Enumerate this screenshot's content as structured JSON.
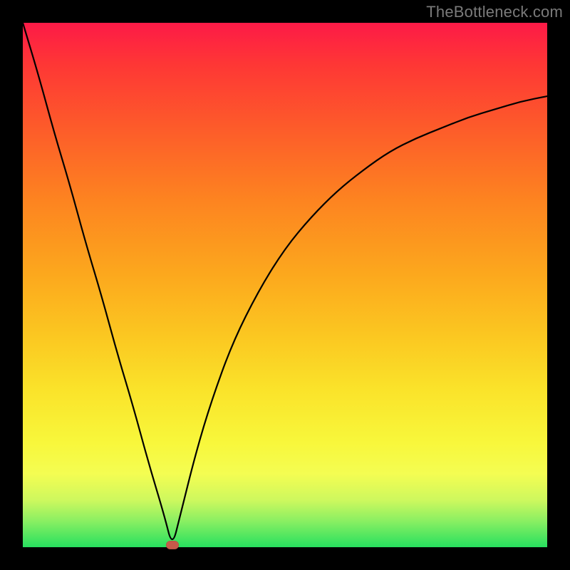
{
  "watermark": "TheBottleneck.com",
  "colors": {
    "curve_stroke": "#000000",
    "marker_fill": "#c75a4a",
    "frame": "#000000"
  },
  "chart_data": {
    "type": "line",
    "title": "",
    "xlabel": "",
    "ylabel": "",
    "xlim": [
      0,
      100
    ],
    "ylim": [
      0,
      100
    ],
    "grid": false,
    "legend": false,
    "series": [
      {
        "name": "bottleneck-curve",
        "x": [
          0,
          3,
          6,
          9,
          12,
          15,
          18,
          21,
          24,
          27,
          28.5,
          30,
          33,
          36,
          40,
          45,
          50,
          55,
          60,
          65,
          70,
          75,
          80,
          85,
          90,
          95,
          100
        ],
        "values": [
          100,
          90,
          79,
          69,
          58,
          48,
          37,
          27,
          16,
          6,
          0,
          6,
          18,
          28,
          39,
          49,
          57,
          63,
          68,
          72,
          75.5,
          78,
          80,
          82,
          83.5,
          85,
          86
        ]
      }
    ],
    "annotations": [
      {
        "name": "min-marker",
        "x": 28.5,
        "y": 0
      }
    ]
  }
}
